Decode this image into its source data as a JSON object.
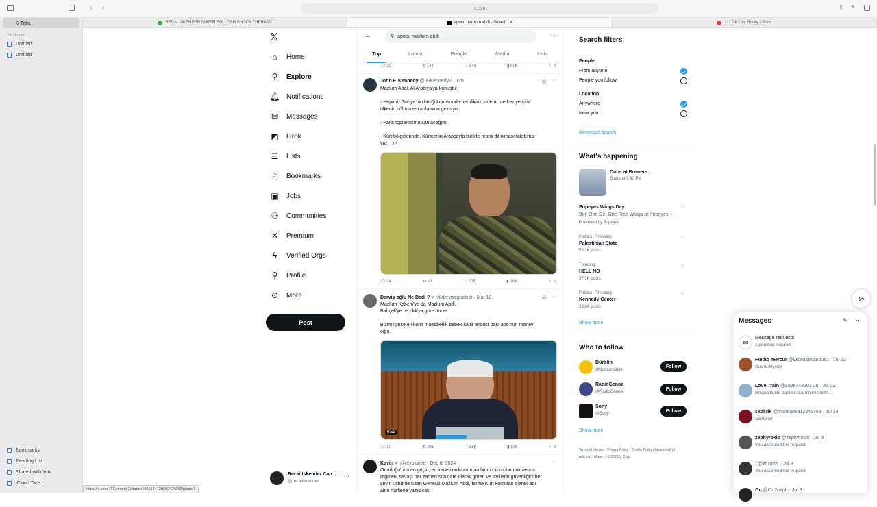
{
  "browser": {
    "address": "x.com",
    "tabs": [
      "RECAI IŞKENDER SUPER FOLLOSH SHOCK THERAPY",
      "apocu mazlum abdi - Search / X",
      "111 Dk 2 by Rocky - Suno"
    ],
    "sidebar": {
      "tab_count": "3 Tabs",
      "group_header": "Tab Groups",
      "groups": [
        "Untitled",
        "Untitled"
      ],
      "bottom": [
        "Bookmarks",
        "Reading List",
        "Shared with You",
        "iCloud Tabs"
      ]
    },
    "status_url": "https://x.com/JFKennedy2/status/1960144720592426863/photo/1"
  },
  "nav": {
    "items": [
      "Home",
      "Explore",
      "Notifications",
      "Messages",
      "Grok",
      "Lists",
      "Bookmarks",
      "Jobs",
      "Communities",
      "Premium",
      "Verified Orgs",
      "Profile",
      "More"
    ],
    "post": "Post",
    "account": {
      "name": "Recai Iskender Can...",
      "handle": "@recaiiskender"
    }
  },
  "search": {
    "query": "apocu mazlum abdi",
    "tabs": [
      "Top",
      "Latest",
      "People",
      "Media",
      "Lists"
    ]
  },
  "prev_actions": {
    "reply": "20",
    "rt": "144",
    "like": "840",
    "views": "80K"
  },
  "tweets": [
    {
      "name": "John F. Kennedy",
      "handle": "@JFKennedy2 · 12h",
      "lines": [
        "Mazlum Abdi, Al Arabiya'ya konuştu:",
        "",
        "- Hepimiz Suriye'nin birliği konusunda hemfikiriz; ademi merkeziyetçilik",
        "ülkenin bölünmesi anlamına gelmiyor.",
        "",
        "- Paris toplantısına katılacağım.",
        "",
        "- Kürt bölgelerinde, Kürtçenin Arapçayla birlikte resmi dil olması talebimiz",
        "var. +++"
      ],
      "reply": "14",
      "rt": "12",
      "like": "205",
      "views": "28K"
    },
    {
      "name": "Derviş oğlu Ne Dedi ?",
      "handle": "@dervisogludedi · Mar 12",
      "lines": [
        "Mazlum Kobeni'ye da Mazlum Abdi,",
        "Bahçeli'ye ve pkk'ya göre önder.",
        "",
        "Bizim içinse eli kanlı müebbetlik bebek katili terörist başı apo'nun manevi",
        "oğlu."
      ],
      "video_time": "0:52",
      "reply": "10",
      "rt": "105",
      "like": "558",
      "views": "10K"
    },
    {
      "name": "Kevin",
      "handle": "@revolutiee · Dec 6, 2024",
      "lines": [
        "Ortadoğu'nun en güçlü, en iradeli ordularından birinin komutanı olmasına",
        "rağmen, savaşı her zaman son çare olarak gören ve sivillerin güvenliğini her",
        "şeyin üstünde tutan General Mazlum Abdi, tarihe Kürt komutan olarak adı",
        "altın harflerle yazılacak."
      ]
    }
  ],
  "filters": {
    "title": "Search filters",
    "people": "People",
    "from_anyone": "From anyone",
    "you_follow": "People you follow",
    "location": "Location",
    "anywhere": "Anywhere",
    "near_you": "Near you",
    "advanced": "Advanced search"
  },
  "happening": {
    "title": "What's happening",
    "event": {
      "name": "Cubs at Brewers",
      "sub": "Starts at 7:40 PM"
    },
    "promo": {
      "name": "Popeyes Wings Day",
      "desc": "Buy One Get One Free Wings at Popeyes ++",
      "by": "Promoted by Popeyes"
    },
    "trends": [
      {
        "cat": "Politics · Trending",
        "name": "Palestinian State",
        "posts": "53.1K posts"
      },
      {
        "cat": "Trending",
        "name": "HELL NO",
        "posts": "37.7K posts"
      },
      {
        "cat": "Politics · Trending",
        "name": "Kennedy Center",
        "posts": "23.8K posts"
      }
    ],
    "show_more": "Show more"
  },
  "who": {
    "title": "Who to follow",
    "people": [
      {
        "name": "Dürbün",
        "handle": "@durbunhaber",
        "color": "#f4c20d"
      },
      {
        "name": "RadioGenoa",
        "handle": "@RadioGenoa",
        "color": "#3b4a8a"
      },
      {
        "name": "Sony",
        "handle": "@Sony",
        "color": "#111111"
      }
    ],
    "follow": "Follow",
    "show_more": "Show more"
  },
  "footer": [
    "Terms of Service",
    "Privacy Policy",
    "Cookie Policy",
    "Accessibility",
    "Ads info",
    "More ···",
    "© 2025 X Corp."
  ],
  "messages": {
    "title": "Messages",
    "requests": "Message requests",
    "requests_sub": "1 pending request",
    "list": [
      {
        "name": "Fındıq mercür",
        "handle": "@Oswaldmandus2 · Jul 22",
        "msg": "Sus türkiyede",
        "color": "#a0522d"
      },
      {
        "name": "Love Train",
        "handle": "@Love743201 26 · Jul 22",
        "msg": "Recaiallahim banimi acarmisiniz lutfn ...",
        "color": "#8fb3c9"
      },
      {
        "name": "skdkdk",
        "handle": "@miamamia12345765 · Jul 14",
        "msg": "Sahtekar",
        "color": "#7a1020"
      },
      {
        "name": "zephyroxis",
        "handle": "@zephyroxis · Jul 9",
        "msg": "You accepted the request",
        "color": "#555"
      },
      {
        "name": ".",
        "handle": "@znxdxls · Jul 8",
        "msg": "You accepted the request",
        "color": "#333"
      },
      {
        "name": "On",
        "handle": "@On7ralph · Jul 8",
        "msg": "",
        "color": "#222"
      }
    ]
  }
}
